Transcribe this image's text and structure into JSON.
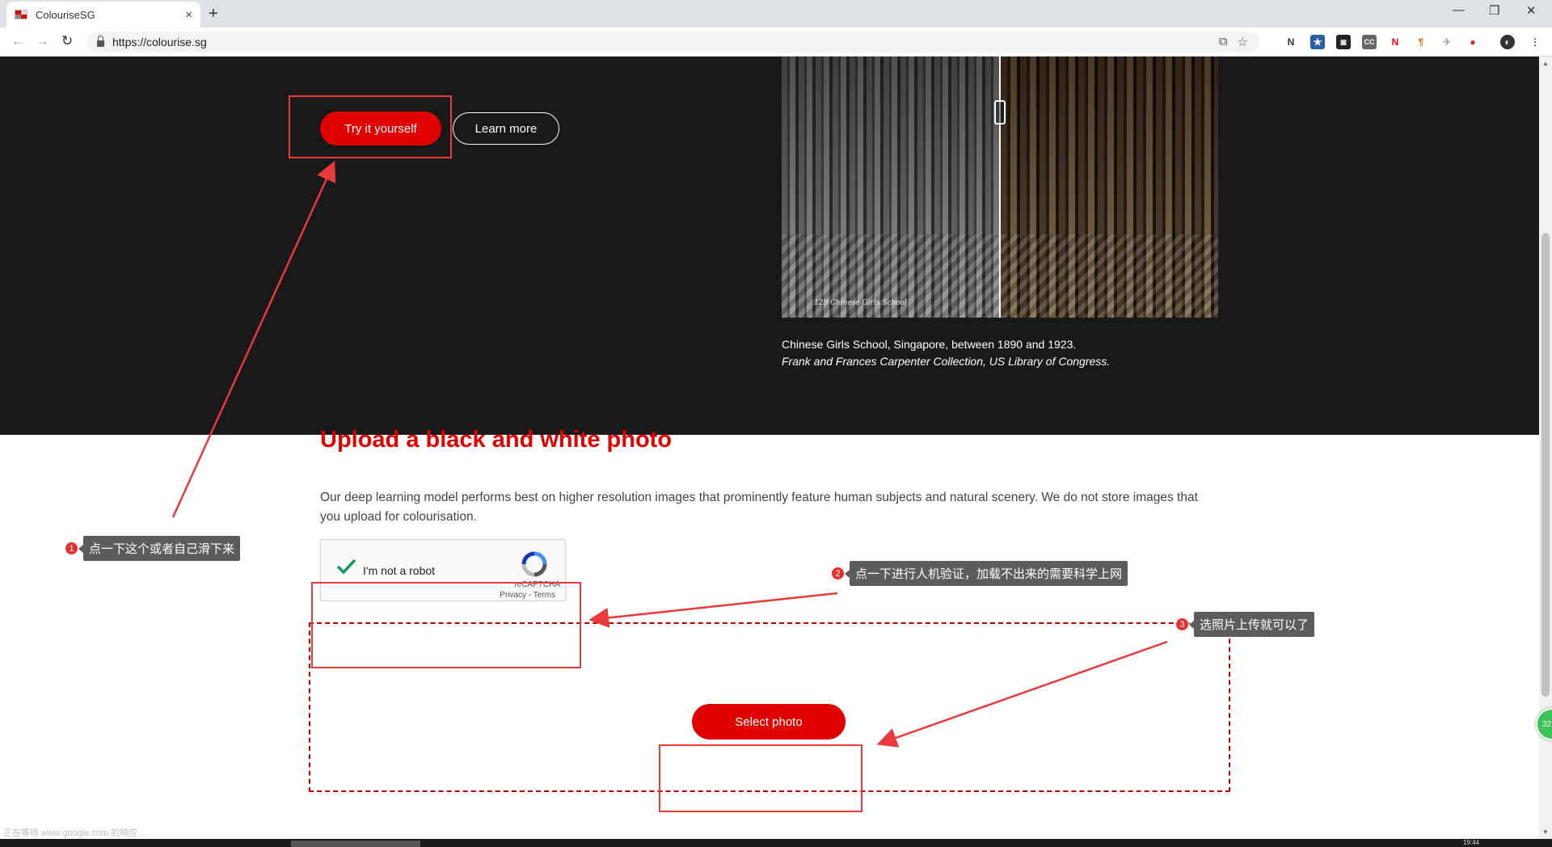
{
  "browser": {
    "tab_title": "ColouriseSG",
    "tab_close": "×",
    "new_tab": "+",
    "url": "https://colourise.sg",
    "window_controls": [
      "—",
      "❐",
      "✕"
    ],
    "nav_icons": [
      "back-icon",
      "forward-icon",
      "reload-icon"
    ],
    "extensions": [
      "translate-icon",
      "star-icon",
      "ext-n-icon",
      "ext-star-icon",
      "ext-ghost-icon",
      "ext-cc-icon",
      "ext-netflix-icon",
      "ext-pilcrow-icon",
      "ext-bird-icon",
      "ext-record-icon",
      "profile-icon",
      "menu-icon"
    ]
  },
  "hero": {
    "try_label": "Try it yourself",
    "learn_label": "Learn more",
    "photo_watermark": "129 Chinese Girls School",
    "caption_line1": "Chinese Girls School, Singapore, between 1890 and 1923.",
    "caption_line2": "Frank and Frances Carpenter Collection, US Library of Congress."
  },
  "upload": {
    "title": "Upload a black and white photo",
    "description": "Our deep learning model performs best on higher resolution images that prominently feature human subjects and natural scenery. We do not store images that you upload for colourisation.",
    "captcha_label": "I'm not a robot",
    "captcha_brand": "reCAPTCHA",
    "captcha_links": "Privacy - Terms",
    "select_label": "Select photo"
  },
  "annotations": [
    {
      "num": "1",
      "text": "点一下这个或者自己滑下来"
    },
    {
      "num": "2",
      "text": "点一下进行人机验证，加载不出来的需要科学上网"
    },
    {
      "num": "3",
      "text": "选照片上传就可以了"
    }
  ],
  "status": {
    "text": "正在等待 www.google.com 的响应...",
    "clock": "19:44",
    "float_badge": "32"
  },
  "colors": {
    "brand_red": "#e00000",
    "hero_bg": "#1a1919",
    "annotation_red": "#e83a3a"
  }
}
